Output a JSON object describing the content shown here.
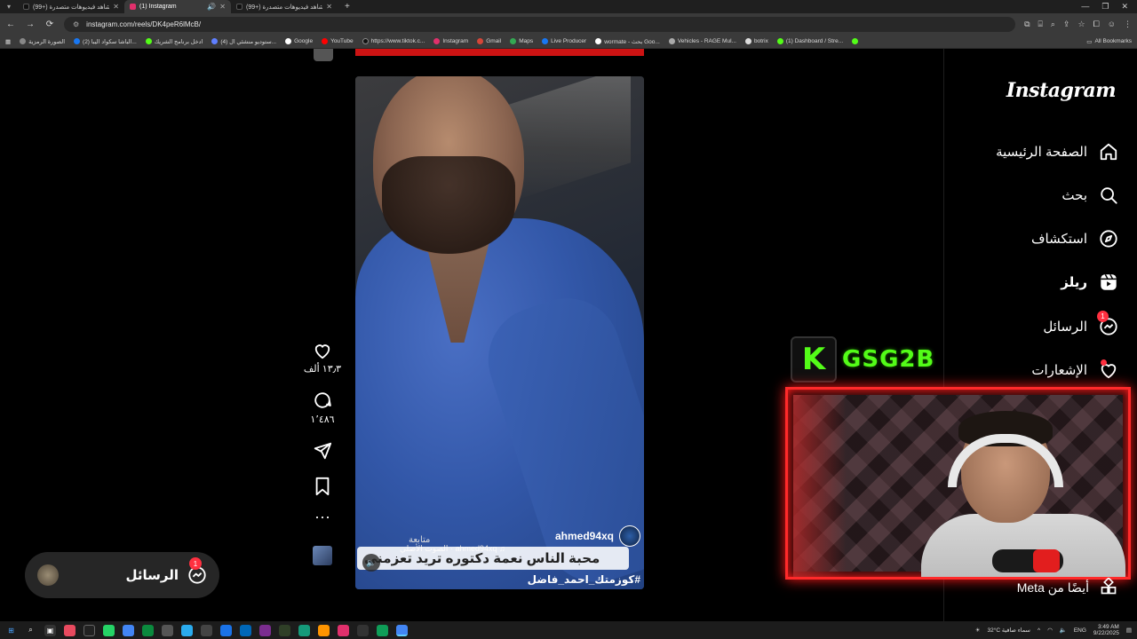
{
  "browser": {
    "tabs": [
      {
        "title": "(99+) شاهد فيديوهات متصدرة |",
        "color": "#111111",
        "active": false
      },
      {
        "title": "(1) Instagram",
        "color": "#e1306c",
        "active": true
      },
      {
        "title": "(99+) شاهد فيديوهات متصدرة |",
        "color": "#111111",
        "active": false
      }
    ],
    "new_tab": "+",
    "url": "instagram.com/reels/DK4peR6lMcB/",
    "bookmarks": [
      "الصورة الرمزية",
      "(2) الباشا سكواد اليبا...",
      "ادخل برنامج الشريك",
      "(4) ستوديو منشئي ال...",
      "Google",
      "YouTube",
      "https://www.tiktok.c...",
      "Instagram",
      "Gmail",
      "Maps",
      "Live Producer",
      "wormate - بحث Goo...",
      "Vehicles - RAGE Mul...",
      "botrix",
      "(1) Dashboard / Stre..."
    ],
    "all_bookmarks": "All Bookmarks"
  },
  "sidebar": {
    "logo": "Instagram",
    "items": [
      {
        "label": "الصفحة الرئيسية",
        "icon": "home-icon"
      },
      {
        "label": "بحث",
        "icon": "search-icon"
      },
      {
        "label": "استكشاف",
        "icon": "compass-icon"
      },
      {
        "label": "ريلز",
        "icon": "reels-icon"
      },
      {
        "label": "الرسائل",
        "icon": "messenger-icon",
        "badge": "1"
      },
      {
        "label": "الإشعارات",
        "icon": "heart-icon"
      }
    ],
    "more_from_meta": "أيضًا من Meta"
  },
  "reel": {
    "author": "ahmed94xq",
    "audio": "ahmed94xq · الصوت الأصلي",
    "follow": "متابعة",
    "caption": "محبة الناس نعمة دكتوره تريد تعزمني",
    "hashtag": "#كوزمتك_احمد_فاضل",
    "likes": "١٣٫٣ ألف",
    "comments": "١٬٤٨٦"
  },
  "messages_pill": {
    "label": "الرسائل",
    "badge": "1"
  },
  "overlay": {
    "logo_letter": "K",
    "channel_name": "GSG2B",
    "brand_color": "#53fc18",
    "frame_color": "#ff2a2a"
  },
  "taskbar": {
    "weather": "32°C  سماء صافية",
    "lang": "ENG",
    "time": "3:49 AM",
    "date": "9/22/2025"
  }
}
